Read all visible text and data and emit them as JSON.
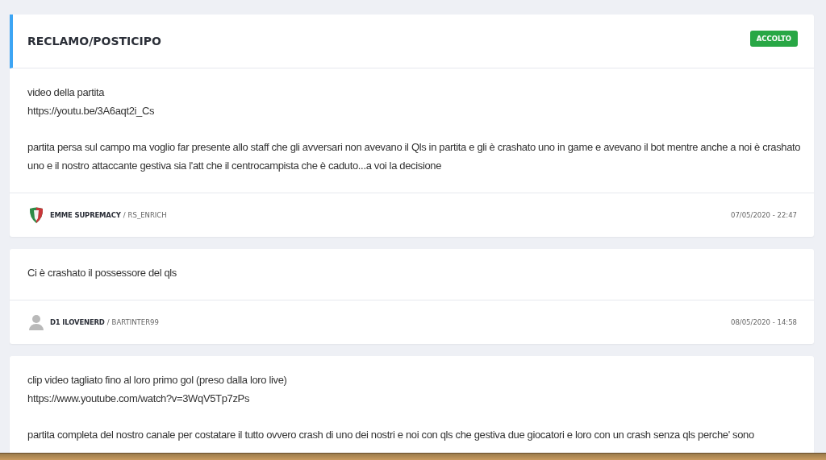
{
  "posts": [
    {
      "header": {
        "title": "RECLAMO/POSTICIPO",
        "badge": {
          "label": "ACCOLTO",
          "color": "#28a745"
        }
      },
      "paragraphs": [
        [
          "video della partita",
          "https://youtu.be/3A6aqt2i_Cs"
        ],
        [
          "partita persa sul campo ma voglio far presente allo staff che gli avversari non avevano il Qls in partita e gli è crashato uno in game e avevano il bot mentre anche a noi è crashato uno e il nostro attaccante gestiva sia l'att che il centrocampista che è caduto...a voi la decisione"
        ]
      ],
      "footer": {
        "avatar": {
          "kind": "shield"
        },
        "team": "EMME SUPREMACY",
        "separator": "/",
        "user": "RS_ENRICH",
        "date": "07/05/2020 - 22:47"
      }
    },
    {
      "paragraphs": [
        [
          "Ci è crashato il possessore del qls"
        ]
      ],
      "footer": {
        "avatar": {
          "kind": "person"
        },
        "team": "D1 ILOVENERD",
        "separator": "/",
        "user": "BARTINTER99",
        "date": "08/05/2020 - 14:58"
      }
    },
    {
      "paragraphs": [
        [
          "clip video tagliato fino al loro primo gol (preso dalla loro live)",
          "https://www.youtube.com/watch?v=3WqV5Tp7zPs"
        ],
        [
          "partita completa del nostro canale per costatare il tutto ovvero crash di uno dei nostri e noi con qls che gestiva due giocatori e loro con un crash senza qls perche' sono"
        ]
      ]
    }
  ]
}
